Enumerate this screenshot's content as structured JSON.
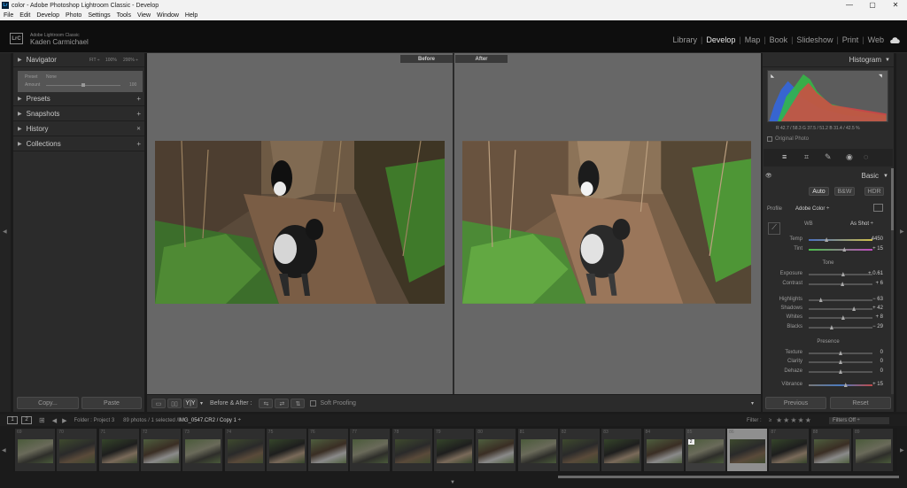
{
  "window": {
    "title": "color - Adobe Photoshop Lightroom Classic - Develop",
    "min": "—",
    "max": "▢",
    "close": "✕"
  },
  "menu": [
    "File",
    "Edit",
    "Develop",
    "Photo",
    "Settings",
    "Tools",
    "View",
    "Window",
    "Help"
  ],
  "identity": {
    "logo": "LrC",
    "app": "Adobe Lightroom Classic",
    "user": "Kaden Carmichael"
  },
  "modules": [
    "Library",
    "Develop",
    "Map",
    "Book",
    "Slideshow",
    "Print",
    "Web"
  ],
  "left": {
    "navigator": {
      "label": "Navigator",
      "zoom": [
        "FIT ÷",
        "100%",
        "200% ÷"
      ],
      "preset": "Preset",
      "preset_val": "None",
      "amount": "Amount",
      "amount_val": "100"
    },
    "panels": [
      "Presets",
      "Snapshots",
      "History",
      "Collections"
    ],
    "history_clear": "✕",
    "copy": "Copy...",
    "paste": "Paste"
  },
  "center": {
    "before": "Before",
    "after": "After",
    "before_after": "Before & After :",
    "soft_proofing": "Soft Proofing",
    "yy": "Y|Y"
  },
  "right": {
    "histogram": "Histogram",
    "rgb": {
      "r_label": "R",
      "r": "42.7 / 58.3",
      "g_label": "G",
      "g": "37.5 / 51.2",
      "b_label": "B",
      "b": "31.4 / 42.5",
      "unit": "%"
    },
    "original_photo": "Original Photo",
    "basic": "Basic",
    "treatment": [
      "Auto",
      "B&W",
      "HDR"
    ],
    "profile_label": "Profile",
    "profile": "Adobe Color ÷",
    "wb_label": "WB",
    "wb": "As Shot ÷",
    "temp": {
      "label": "Temp",
      "value": "4450",
      "pos": 0.28
    },
    "tint": {
      "label": "Tint",
      "value": "+ 15",
      "pos": 0.56
    },
    "tone": "Tone",
    "exposure": {
      "label": "Exposure",
      "value": "+ 0.61",
      "pos": 0.54
    },
    "contrast": {
      "label": "Contrast",
      "value": "+ 6",
      "pos": 0.53
    },
    "highlights": {
      "label": "Highlights",
      "value": "− 63",
      "pos": 0.19
    },
    "shadows": {
      "label": "Shadows",
      "value": "+ 42",
      "pos": 0.71
    },
    "whites": {
      "label": "Whites",
      "value": "+ 8",
      "pos": 0.54
    },
    "blacks": {
      "label": "Blacks",
      "value": "− 29",
      "pos": 0.36
    },
    "presence": "Presence",
    "texture": {
      "label": "Texture",
      "value": "0",
      "pos": 0.5
    },
    "clarity": {
      "label": "Clarity",
      "value": "0",
      "pos": 0.5
    },
    "dehaze": {
      "label": "Dehaze",
      "value": "0",
      "pos": 0.5
    },
    "vibrance": {
      "label": "Vibrance",
      "value": "+ 15",
      "pos": 0.58
    },
    "previous": "Previous",
    "reset": "Reset"
  },
  "filmbar": {
    "screens": [
      "1",
      "2"
    ],
    "folder": "Folder : Project 3",
    "count": "89 photos / 1 selected / ",
    "file": "IMG_0547.CR2 / Copy 1 ÷",
    "filter": "Filter :",
    "filter_mode": "≥",
    "filters_off": "Filters Off ÷"
  },
  "film": {
    "nums": [
      "69",
      "70",
      "71",
      "72",
      "73",
      "74",
      "75",
      "76",
      "77",
      "78",
      "79",
      "80",
      "81",
      "82",
      "83",
      "84",
      "85",
      "86",
      "87",
      "88",
      "89"
    ],
    "badge": "2",
    "cur_index": 17
  }
}
